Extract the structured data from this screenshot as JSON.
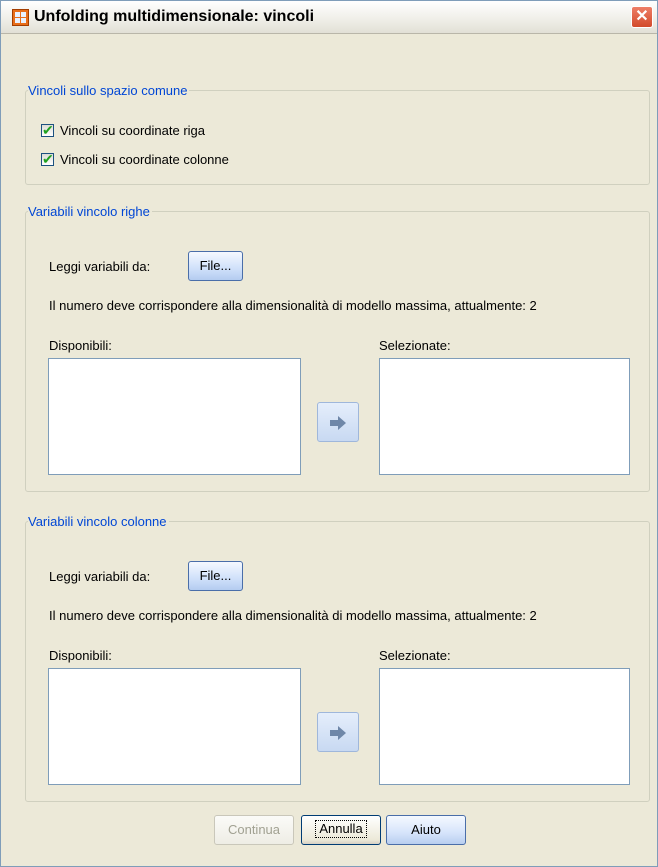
{
  "window": {
    "title": "Unfolding multidimensionale: vincoli",
    "close_glyph": "✕",
    "icon": "spss-data-grid-icon"
  },
  "common_space": {
    "legend": "Vincoli sullo spazio comune",
    "checkboxes": [
      {
        "label": "Vincoli su coordinate riga",
        "checked": true
      },
      {
        "label": "Vincoli su coordinate colonne",
        "checked": true
      }
    ]
  },
  "row_vars": {
    "legend": "Variabili vincolo righe",
    "read_label": "Leggi variabili da:",
    "file_button": "File...",
    "note": "Il numero deve corrispondere alla dimensionalità di modello massima, attualmente: 2",
    "available_label": "Disponibili:",
    "selected_label": "Selezionate:",
    "move_icon": "right-arrow-icon"
  },
  "col_vars": {
    "legend": "Variabili vincolo colonne",
    "read_label": "Leggi variabili da:",
    "file_button": "File...",
    "note": "Il numero deve corrispondere alla dimensionalità di modello massima, attualmente: 2",
    "available_label": "Disponibili:",
    "selected_label": "Selezionate:",
    "move_icon": "right-arrow-icon"
  },
  "footer": {
    "continue": "Continua",
    "cancel": "Annulla",
    "help": "Aiuto"
  },
  "colors": {
    "dialog_bg": "#ece9d8",
    "group_legend": "#0046d5",
    "close_red": "#d24a2a",
    "check_green": "#21a121"
  }
}
